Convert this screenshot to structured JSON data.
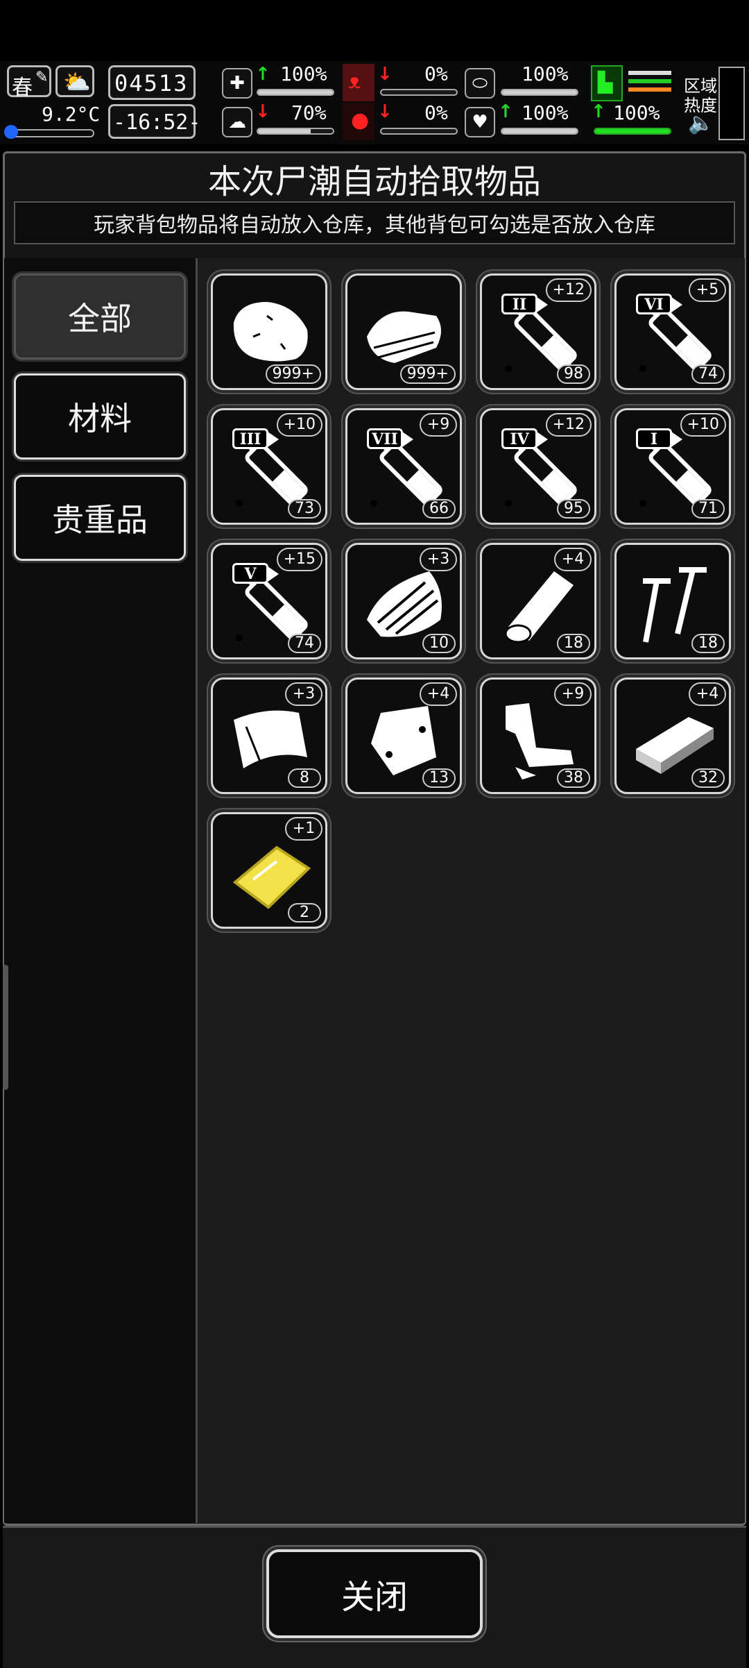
{
  "hud": {
    "season": "春",
    "temperature": "9.2°C",
    "day_counter": "04513",
    "clock": "-16:52-",
    "stats": {
      "health": {
        "value": "100%",
        "trend": "up",
        "level": 1.0
      },
      "hunger": {
        "value": "0%",
        "trend": "down",
        "level": 0.0
      },
      "pills": {
        "value": "100%",
        "trend": "none",
        "level": 1.0
      },
      "mind": {
        "value": "70%",
        "trend": "down",
        "level": 0.7
      },
      "blood": {
        "value": "0%",
        "trend": "down",
        "level": 0.0
      },
      "heart": {
        "value": "100%",
        "trend": "up",
        "level": 1.0
      },
      "stamina": {
        "value": "100%",
        "trend": "up",
        "level": 1.0
      }
    },
    "zone_label_1": "区域",
    "zone_label_2": "热度",
    "icons": {
      "season": "feather-icon",
      "weather": "sun-cloud-icon",
      "health": "medkit-icon",
      "hunger": "stomach-icon",
      "pills": "capsule-icon",
      "mind": "brain-icon",
      "blood": "blood-drop-icon",
      "heart": "heart-icon",
      "stamina": "boot-icon",
      "sound": "speaker-icon"
    }
  },
  "dialog": {
    "title": "本次尸潮自动拾取物品",
    "subtitle": "玩家背包物品将自动放入仓库，其他背包可勾选是否放入仓库",
    "categories": [
      {
        "label": "全部",
        "active": true
      },
      {
        "label": "材料",
        "active": false
      },
      {
        "label": "贵重品",
        "active": false
      }
    ],
    "items": [
      {
        "icon": "meat-icon",
        "count": "999+",
        "bonus": ""
      },
      {
        "icon": "cloth-icon",
        "count": "999+",
        "bonus": ""
      },
      {
        "icon": "syringe-icon",
        "tier": "II",
        "count": "98",
        "bonus": "+12"
      },
      {
        "icon": "syringe-icon",
        "tier": "VI",
        "count": "74",
        "bonus": "+5"
      },
      {
        "icon": "syringe-icon",
        "tier": "III",
        "count": "73",
        "bonus": "+10"
      },
      {
        "icon": "syringe-icon",
        "tier": "VII",
        "count": "66",
        "bonus": "+9"
      },
      {
        "icon": "syringe-icon",
        "tier": "IV",
        "count": "95",
        "bonus": "+12"
      },
      {
        "icon": "syringe-icon",
        "tier": "I",
        "count": "71",
        "bonus": "+10"
      },
      {
        "icon": "syringe-icon",
        "tier": "V",
        "count": "74",
        "bonus": "+15"
      },
      {
        "icon": "bark-icon",
        "count": "10",
        "bonus": "+3"
      },
      {
        "icon": "log-icon",
        "count": "18",
        "bonus": "+4"
      },
      {
        "icon": "nails-icon",
        "count": "18",
        "bonus": ""
      },
      {
        "icon": "plastic-sheet-icon",
        "count": "8",
        "bonus": "+3"
      },
      {
        "icon": "bag-icon",
        "count": "13",
        "bonus": "+4"
      },
      {
        "icon": "scrap-metal-icon",
        "count": "38",
        "bonus": "+9"
      },
      {
        "icon": "brick-icon",
        "count": "32",
        "bonus": "+4"
      },
      {
        "icon": "gold-plate-icon",
        "count": "2",
        "bonus": "+1"
      }
    ],
    "close_label": "关闭"
  }
}
